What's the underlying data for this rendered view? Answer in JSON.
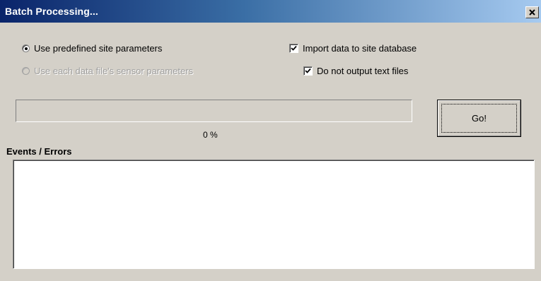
{
  "window": {
    "title": "Batch Processing...",
    "close_glyph": "X"
  },
  "options": {
    "use_predefined": {
      "label": "Use predefined site parameters",
      "checked": true,
      "enabled": true
    },
    "use_sensor": {
      "label": "Use each data file's sensor parameters",
      "checked": false,
      "enabled": false
    },
    "import_to_db": {
      "label": "Import data to site database",
      "checked": true
    },
    "no_text_files": {
      "label": "Do not output text files",
      "checked": true
    }
  },
  "progress": {
    "value": 0,
    "label": "0 %"
  },
  "go_button": {
    "label": "Go!"
  },
  "events": {
    "label": "Events / Errors",
    "content": ""
  },
  "colors": {
    "title_start": "#0a246a",
    "title_end": "#a6caf0",
    "face": "#d4d0c8"
  }
}
